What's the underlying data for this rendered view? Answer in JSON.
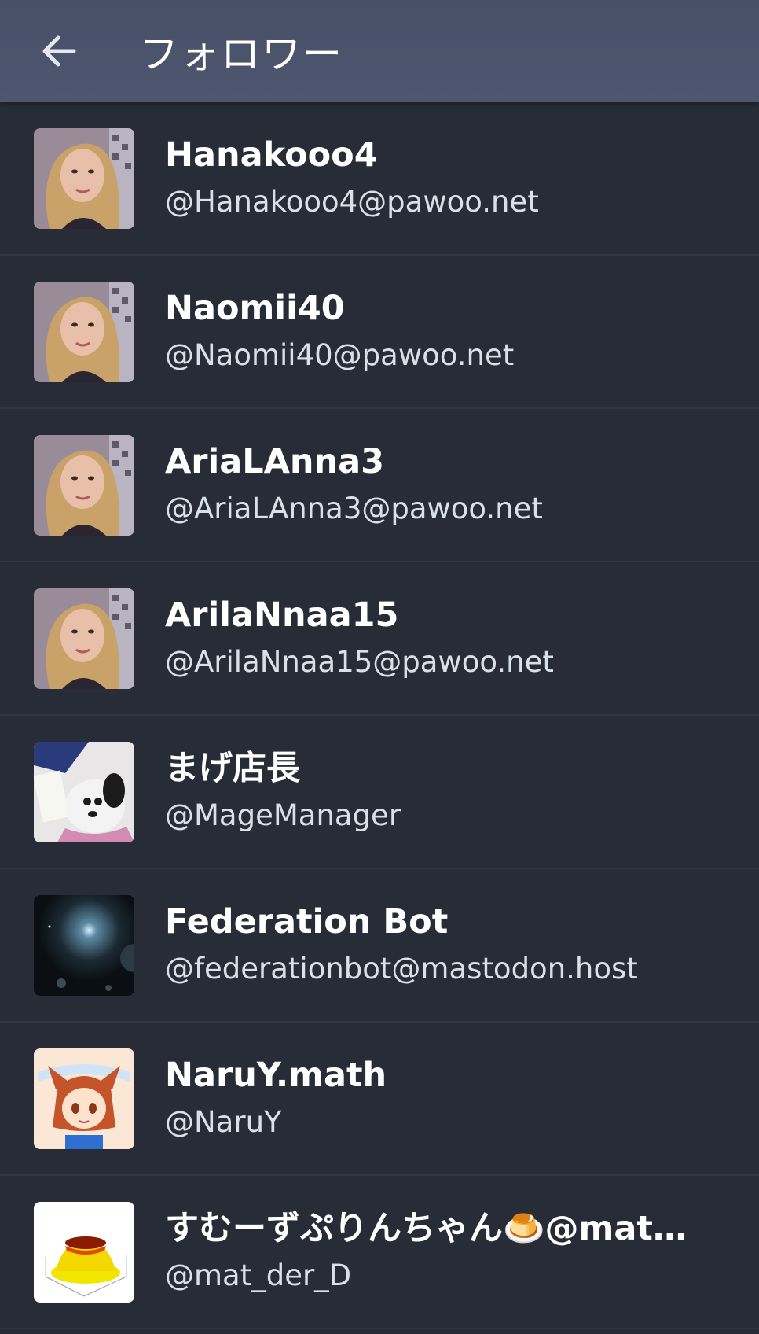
{
  "header": {
    "title": "フォロワー",
    "back_icon": "arrow-left-icon"
  },
  "colors": {
    "background": "#282c37",
    "header": "#4f5770",
    "divider": "#313543",
    "name": "#ffffff",
    "acct": "#d9e1e8"
  },
  "followers": [
    {
      "display_name": "Hanakooo4",
      "acct": "@Hanakooo4@pawoo.net",
      "avatar": "portrait-avatar"
    },
    {
      "display_name": "Naomii40",
      "acct": "@Naomii40@pawoo.net",
      "avatar": "portrait-avatar"
    },
    {
      "display_name": "AriaLAnna3",
      "acct": "@AriaLAnna3@pawoo.net",
      "avatar": "portrait-avatar"
    },
    {
      "display_name": "ArilaNnaa15",
      "acct": "@ArilaNnaa15@pawoo.net",
      "avatar": "portrait-avatar"
    },
    {
      "display_name": "まげ店長",
      "acct": "@MageManager",
      "avatar": "plush-toy-avatar"
    },
    {
      "display_name": "Federation Bot",
      "acct": "@federationbot@mastodon.host",
      "avatar": "space-avatar"
    },
    {
      "display_name": "NaruY.math",
      "acct": "@NaruY",
      "avatar": "anime-avatar"
    },
    {
      "display_name": "すむーずぷりんちゃん🍮@mat…",
      "acct": "@mat_der_D",
      "avatar": "pudding-plot-avatar"
    }
  ]
}
